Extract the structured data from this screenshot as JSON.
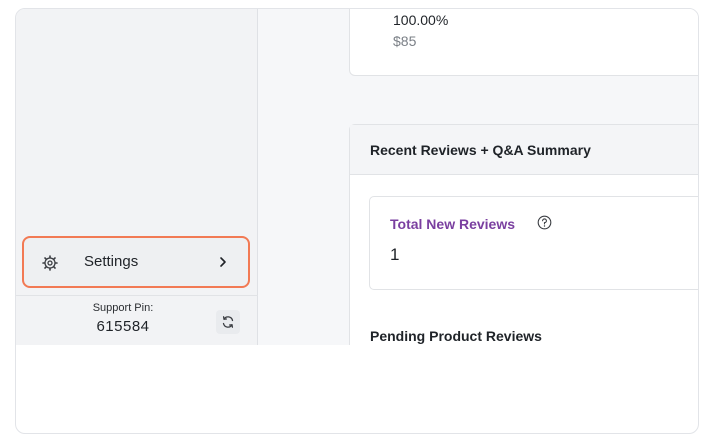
{
  "sidebar": {
    "settings": {
      "label": "Settings",
      "icon": "gear-icon",
      "chevron_icon": "chevron-right-icon"
    },
    "support": {
      "label": "Support Pin:",
      "pin": "615584",
      "refresh_icon": "refresh-icon"
    }
  },
  "main": {
    "top_card": {
      "percent": "100.00%",
      "amount": "$85"
    },
    "reviews_card": {
      "title": "Recent Reviews + Q&A Summary",
      "total_new_reviews": {
        "label": "Total New Reviews",
        "value": "1",
        "help_icon": "help-icon"
      },
      "pending_title": "Pending Product Reviews"
    }
  },
  "colors": {
    "highlight_border": "#f27a54",
    "stat_label": "#7a3fa0",
    "sidebar_bg": "#f2f3f5",
    "main_bg": "#f6f7f9"
  }
}
